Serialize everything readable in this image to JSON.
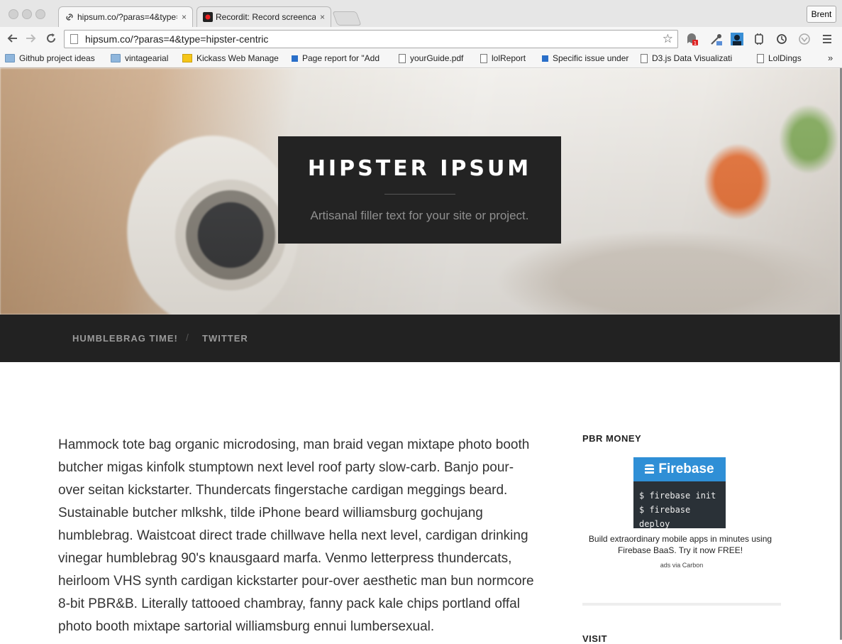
{
  "browser": {
    "tabs": [
      {
        "title": "hipsum.co/?paras=4&type=",
        "close": "×",
        "active": true
      },
      {
        "title": "Recordit: Record screencast",
        "close": "×",
        "active": false
      }
    ],
    "user_button": "Brent",
    "url": "hipsum.co/?paras=4&type=hipster-centric",
    "bookmarks": [
      {
        "label": "Github project ideas",
        "icon": "folder"
      },
      {
        "label": "vintagearial",
        "icon": "folder"
      },
      {
        "label": "Kickass Web Manage",
        "icon": "yellow-doc"
      },
      {
        "label": "Page report for \"Add",
        "icon": "blue-square"
      },
      {
        "label": "yourGuide.pdf",
        "icon": "doc"
      },
      {
        "label": "lolReport",
        "icon": "doc"
      },
      {
        "label": "Specific issue under",
        "icon": "blue-square"
      },
      {
        "label": "D3.js Data Visualizati",
        "icon": "doc"
      },
      {
        "label": "LolDings",
        "icon": "doc"
      }
    ],
    "bookmarks_more": "»",
    "extension_badge": "1"
  },
  "hero": {
    "title": "HIPSTER IPSUM",
    "tagline": "Artisanal filler text for your site or project."
  },
  "nav": {
    "items": [
      "HUMBLEBRAG TIME!",
      "TWITTER"
    ],
    "separator": "/"
  },
  "content": {
    "paragraph": "Hammock tote bag organic microdosing, man braid vegan mixtape photo booth butcher migas kinfolk stumptown next level roof party slow-carb. Banjo pour-over seitan kickstarter. Thundercats fingerstache cardigan meggings beard. Sustainable butcher mlkshk, tilde iPhone beard williamsburg gochujang humblebrag. Waistcoat direct trade chillwave hella next level, cardigan drinking vinegar humblebrag 90's knausgaard marfa. Venmo letterpress thundercats, heirloom VHS synth cardigan kickstarter pour-over aesthetic man bun normcore 8-bit PBR&B. Literally tattooed chambray, fanny pack kale chips portland offal photo booth mixtape sartorial williamsburg ennui lumbersexual."
  },
  "sidebar": {
    "widget_title": "PBR MONEY",
    "ad": {
      "brand": "Firebase",
      "code_lines": [
        "$ firebase init",
        "$ firebase deploy"
      ],
      "text": "Build extraordinary mobile apps in minutes using Firebase BaaS. Try it now FREE!",
      "via": "ads via Carbon"
    },
    "widget_title_2": "VISIT"
  },
  "colors": {
    "title_box": "#232323",
    "nav_bar": "#222222",
    "firebase_blue": "#2f8fd6",
    "ad_dark": "#2a3137"
  }
}
